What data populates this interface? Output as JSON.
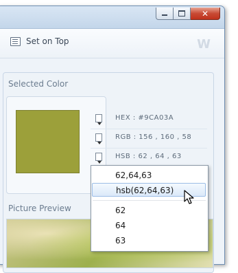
{
  "toolbar": {
    "set_on_top_label": "Set on Top",
    "logo_text": "W"
  },
  "selected_color": {
    "title": "Selected Color",
    "swatch_color": "#9CA03A",
    "hex_label": "HEX : #9CA03A",
    "rgb_label": "RGB : 156 , 160 , 58",
    "hsb_label": "HSB : 62 , 64 , 63"
  },
  "dropdown": {
    "items": [
      "62,64,63",
      "hsb(62,64,63)",
      "62",
      "64",
      "63"
    ],
    "hovered_index": 1
  },
  "preview": {
    "title": "Picture Preview"
  },
  "icons": [
    "minimize-icon",
    "maximize-icon",
    "close-icon",
    "set-on-top-icon",
    "copy-icon",
    "cursor-icon"
  ]
}
